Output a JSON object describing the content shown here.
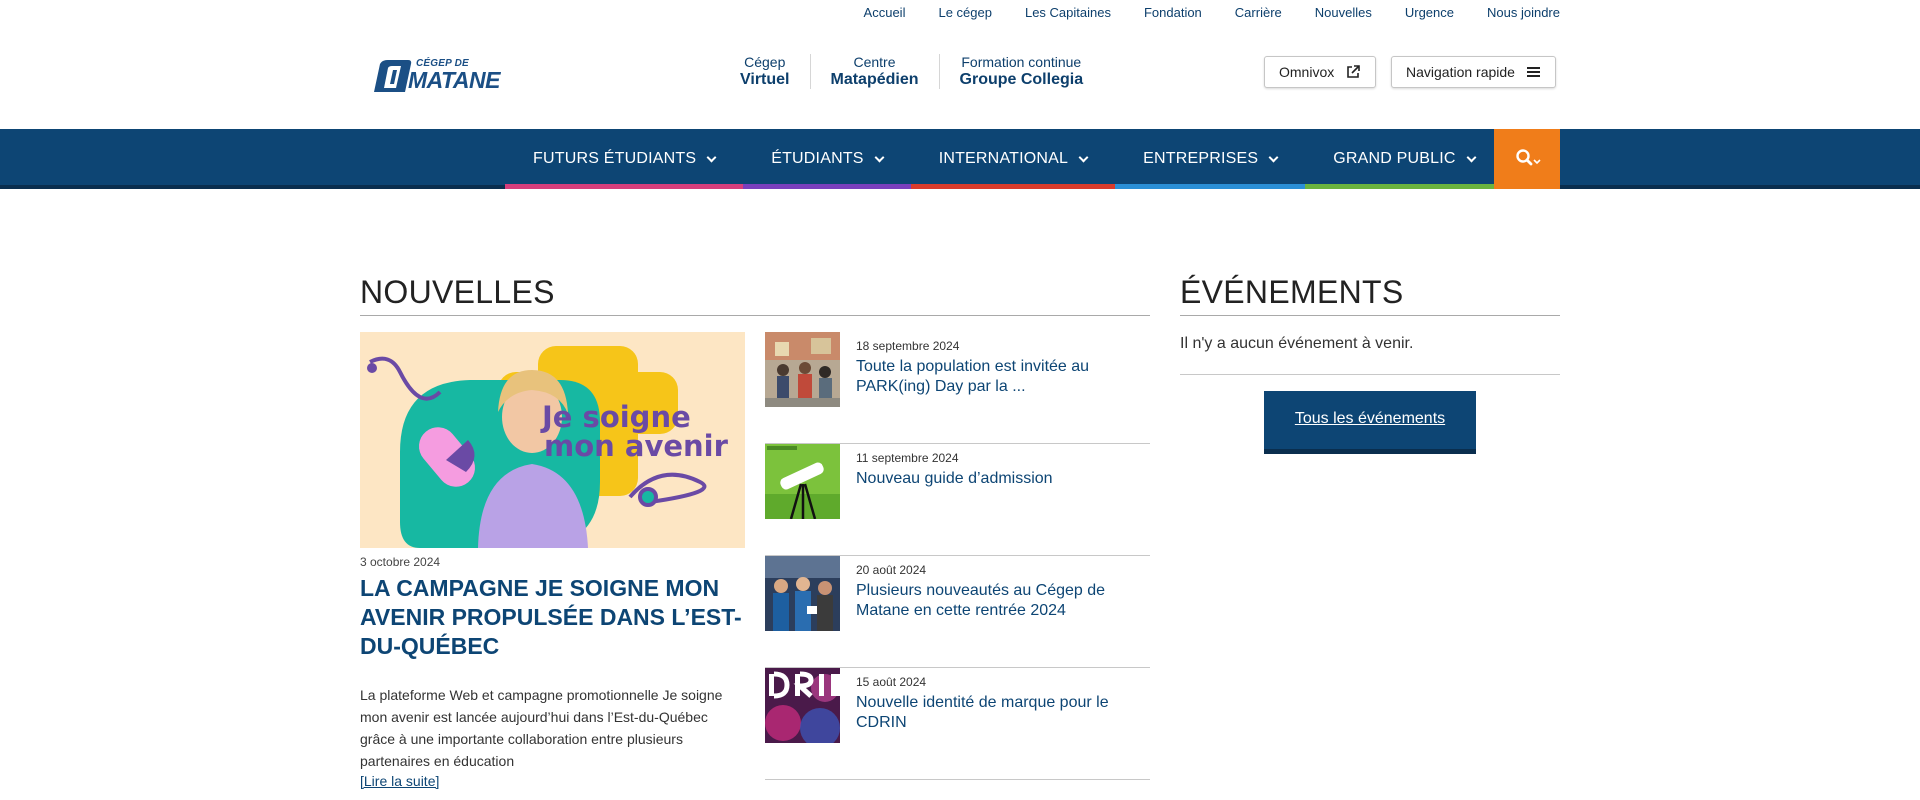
{
  "utility_nav": [
    "Accueil",
    "Le cégep",
    "Les Capitaines",
    "Fondation",
    "Carrière",
    "Nouvelles",
    "Urgence",
    "Nous joindre"
  ],
  "logo": {
    "top": "CÉGEP DE",
    "main": "MATANE"
  },
  "partners": [
    {
      "line1": "Cégep",
      "line2": "Virtuel"
    },
    {
      "line1": "Centre",
      "line2": "Matapédien"
    },
    {
      "line1": "Formation continue",
      "line2": "Groupe Collegia"
    }
  ],
  "header_buttons": {
    "omnivox": "Omnivox",
    "quicknav": "Navigation rapide"
  },
  "main_nav": [
    {
      "label": "FUTURS ÉTUDIANTS",
      "color": "#d63e7c"
    },
    {
      "label": "ÉTUDIANTS",
      "color": "#7a3fbd"
    },
    {
      "label": "INTERNATIONAL",
      "color": "#d93b2b"
    },
    {
      "label": "ENTREPRISES",
      "color": "#2a8fd6"
    },
    {
      "label": "GRAND PUBLIC",
      "color": "#6ab33e"
    }
  ],
  "colors": {
    "nav_bg": "#0d4574",
    "accent": "#f07d1a",
    "link": "#0d4574"
  },
  "news": {
    "title": "NOUVELLES",
    "featured": {
      "image_text_line1": "Je soigne",
      "image_text_line2": "mon avenir",
      "date": "3 octobre 2024",
      "title": "LA CAMPAGNE JE SOIGNE MON AVENIR PROPULSÉE DANS L’EST-DU-QUÉBEC",
      "description": "La plateforme Web et campagne promotionnelle Je soigne mon avenir est lancée aujourd’hui dans l’Est-du-Québec grâce à une importante collaboration entre plusieurs partenaires en éducation",
      "more": "[Lire la suite]"
    },
    "items": [
      {
        "date": "18 septembre 2024",
        "title": "Toute la population est invitée au PARK(ing) Day par la ..."
      },
      {
        "date": "11 septembre 2024",
        "title": "Nouveau guide d’admission"
      },
      {
        "date": "20 août 2024",
        "title": "Plusieurs nouveautés au Cégep de Matane en cette rentrée 2024"
      },
      {
        "date": "15 août 2024",
        "title": "Nouvelle identité de marque pour le CDRIN"
      }
    ]
  },
  "events": {
    "title": "ÉVÉNEMENTS",
    "empty": "Il n'y a aucun événement à venir.",
    "button": "Tous les événements"
  }
}
